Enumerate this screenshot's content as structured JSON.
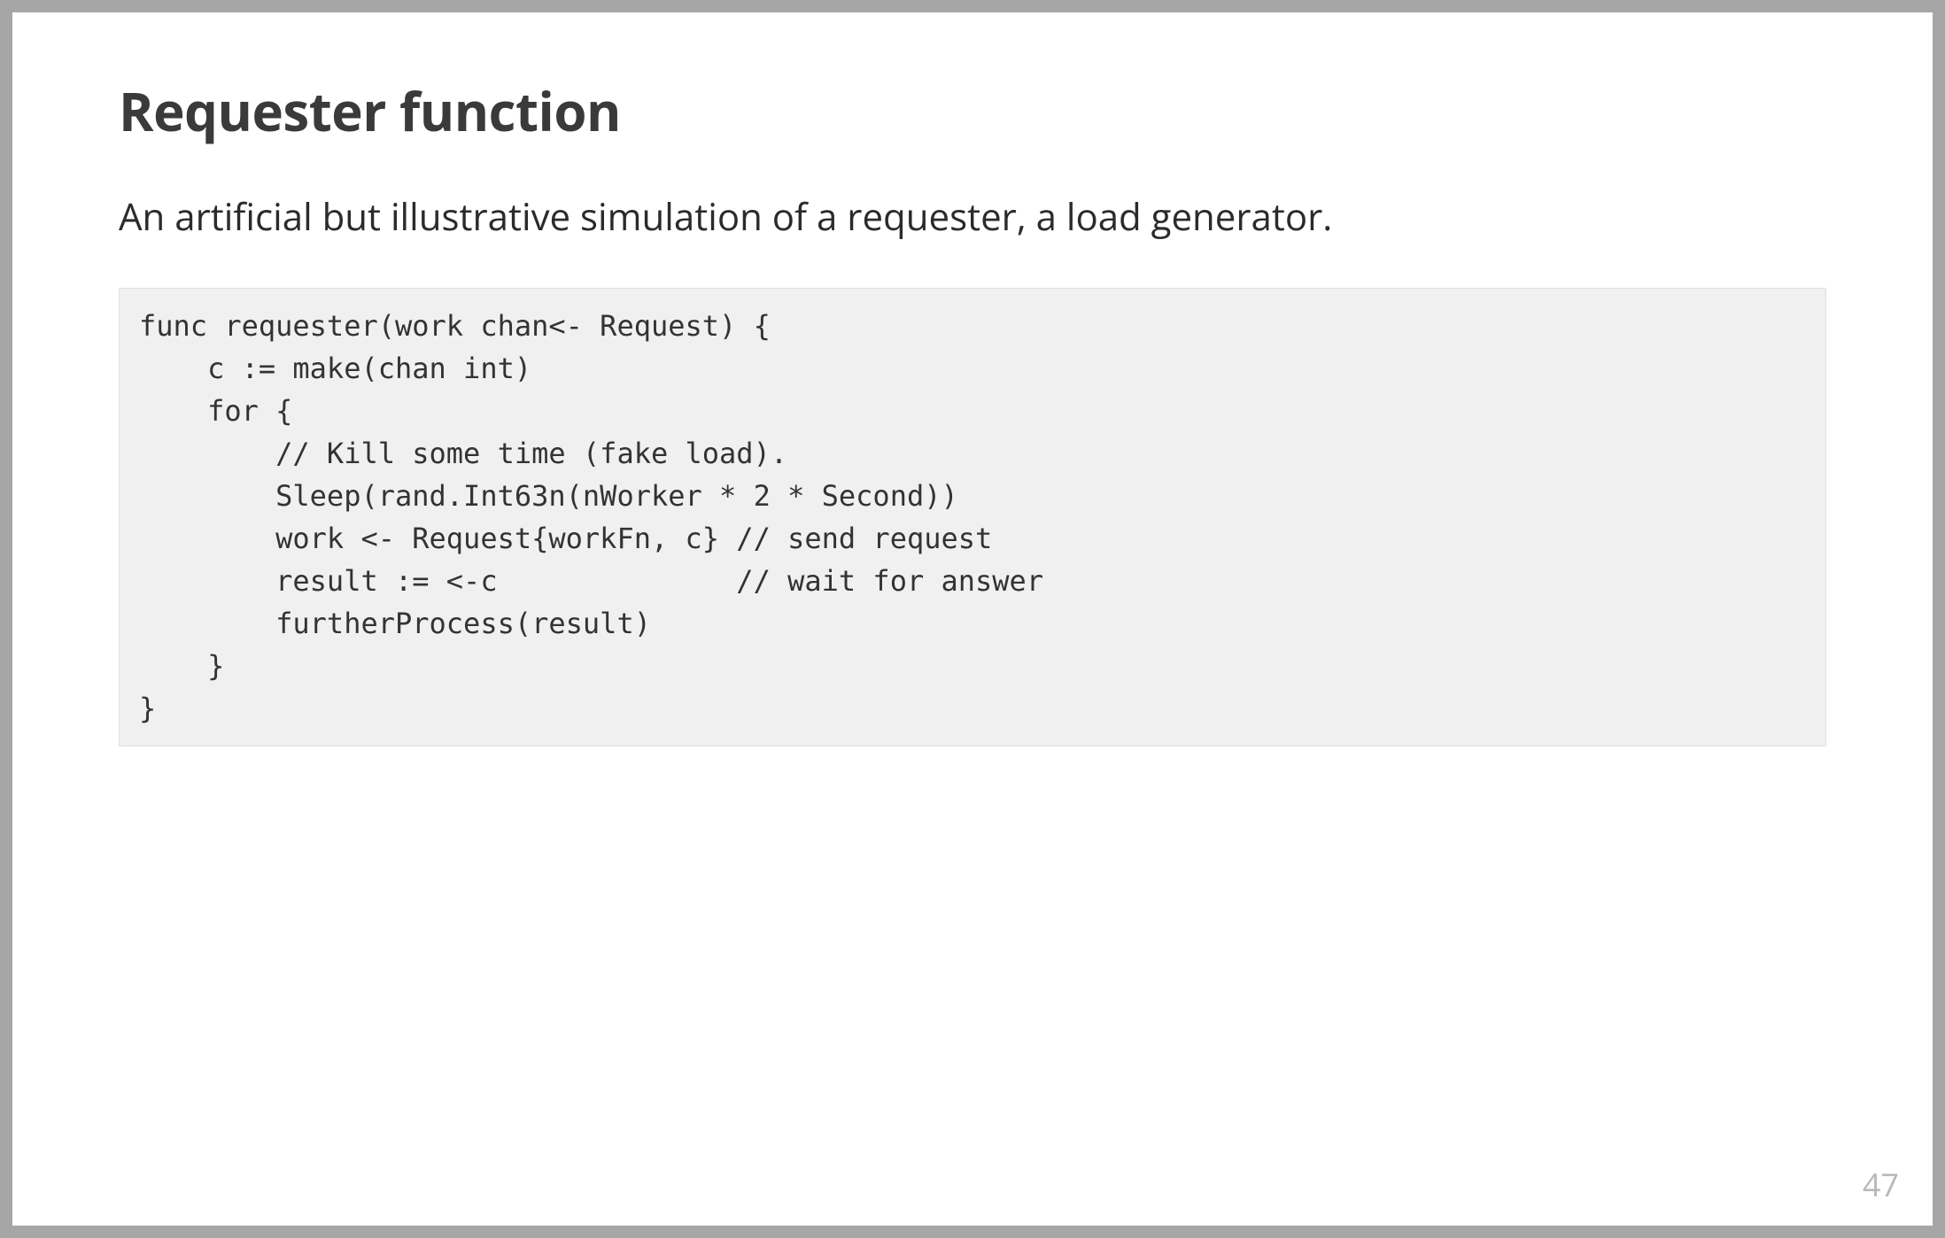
{
  "slide": {
    "title": "Requester function",
    "description": "An artificial but illustrative simulation of a requester, a load generator.",
    "code": "func requester(work chan<- Request) {\n    c := make(chan int)\n    for {\n        // Kill some time (fake load).\n        Sleep(rand.Int63n(nWorker * 2 * Second))\n        work <- Request{workFn, c} // send request\n        result := <-c              // wait for answer\n        furtherProcess(result)\n    }\n}",
    "page_number": "47"
  }
}
